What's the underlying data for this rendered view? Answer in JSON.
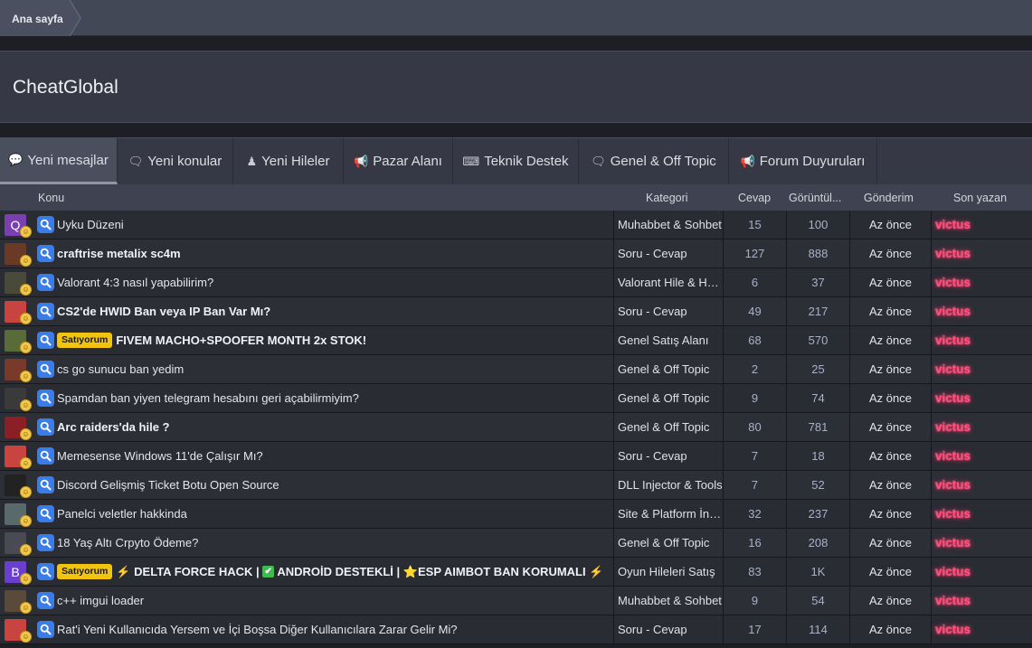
{
  "breadcrumb": {
    "home": "Ana sayfa"
  },
  "page": {
    "title": "CheatGlobal"
  },
  "tabs": [
    {
      "label": "Yeni mesajlar",
      "icon": "speech-bubble-icon",
      "active": true
    },
    {
      "label": "Yeni konular",
      "icon": "chat-bubbles-icon",
      "active": false
    },
    {
      "label": "Yeni Hileler",
      "icon": "user-secret-icon",
      "active": false
    },
    {
      "label": "Pazar Alanı",
      "icon": "megaphone-icon",
      "active": false
    },
    {
      "label": "Teknik Destek",
      "icon": "keyboard-icon",
      "active": false
    },
    {
      "label": "Genel & Off Topic",
      "icon": "chat-bubbles-icon",
      "active": false
    },
    {
      "label": "Forum Duyuruları",
      "icon": "megaphone-icon",
      "active": false
    }
  ],
  "table": {
    "headers": {
      "topic": "Konu",
      "category": "Kategori",
      "replies": "Cevap",
      "views": "Görüntül...",
      "posted": "Gönderim",
      "last_poster": "Son yazan"
    },
    "rows": [
      {
        "title": "Uyku Düzeni",
        "bold": false,
        "prefix": "",
        "category": "Muhabbet & Sohbet",
        "replies": "15",
        "views": "100",
        "time": "Az önce",
        "user": "victus",
        "avatar_color": "#7a3fb0",
        "avatar_letter": "Q"
      },
      {
        "title": "craftrise metalix sc4m",
        "bold": true,
        "prefix": "",
        "category": "Soru - Cevap",
        "replies": "127",
        "views": "888",
        "time": "Az önce",
        "user": "victus",
        "avatar_color": "#6b3a26",
        "avatar_letter": ""
      },
      {
        "title": "Valorant 4:3 nasıl yapabilirim?",
        "bold": false,
        "prefix": "",
        "category": "Valorant Hile & Hack",
        "replies": "6",
        "views": "37",
        "time": "Az önce",
        "user": "victus",
        "avatar_color": "#4a4a3a",
        "avatar_letter": ""
      },
      {
        "title": "CS2'de HWID Ban veya IP Ban Var Mı?",
        "bold": true,
        "prefix": "",
        "category": "Soru - Cevap",
        "replies": "49",
        "views": "217",
        "time": "Az önce",
        "user": "victus",
        "avatar_color": "#c9443e",
        "avatar_letter": ""
      },
      {
        "title": "FIVEM MACHO+SPOOFER MONTH 2x STOK!",
        "bold": true,
        "prefix": "Satıyorum",
        "category": "Genel Satış Alanı",
        "replies": "68",
        "views": "570",
        "time": "Az önce",
        "user": "victus",
        "avatar_color": "#5a6b3a",
        "avatar_letter": ""
      },
      {
        "title": "cs go sunucu ban yedim",
        "bold": false,
        "prefix": "",
        "category": "Genel & Off Topic",
        "replies": "2",
        "views": "25",
        "time": "Az önce",
        "user": "victus",
        "avatar_color": "#7a3a2a",
        "avatar_letter": ""
      },
      {
        "title": "Spamdan ban yiyen telegram hesabını geri açabilirmiyim?",
        "bold": false,
        "prefix": "",
        "category": "Genel & Off Topic",
        "replies": "9",
        "views": "74",
        "time": "Az önce",
        "user": "victus",
        "avatar_color": "#3a3a3a",
        "avatar_letter": ""
      },
      {
        "title": "Arc raiders'da hile ?",
        "bold": true,
        "prefix": "",
        "category": "Genel & Off Topic",
        "replies": "80",
        "views": "781",
        "time": "Az önce",
        "user": "victus",
        "avatar_color": "#8a1f26",
        "avatar_letter": ""
      },
      {
        "title": "Memesense Windows 11'de Çalışır Mı?",
        "bold": false,
        "prefix": "",
        "category": "Soru - Cevap",
        "replies": "7",
        "views": "18",
        "time": "Az önce",
        "user": "victus",
        "avatar_color": "#c9443e",
        "avatar_letter": ""
      },
      {
        "title": "Discord Gelişmiş Ticket Botu Open Source",
        "bold": false,
        "prefix": "",
        "category": "DLL Injector & Tools",
        "replies": "7",
        "views": "52",
        "time": "Az önce",
        "user": "victus",
        "avatar_color": "#222222",
        "avatar_letter": ""
      },
      {
        "title": "Panelci veletler hakkinda",
        "bold": false,
        "prefix": "",
        "category": "Site & Platform İncelemeleri",
        "replies": "32",
        "views": "237",
        "time": "Az önce",
        "user": "victus",
        "avatar_color": "#5a6a6a",
        "avatar_letter": ""
      },
      {
        "title": "18 Yaş Altı Crpyto Ödeme?",
        "bold": false,
        "prefix": "",
        "category": "Genel & Off Topic",
        "replies": "16",
        "views": "208",
        "time": "Az önce",
        "user": "victus",
        "avatar_color": "#4a4a55",
        "avatar_letter": ""
      },
      {
        "title": "DELTA FORCE HACK | ANDROİD DESTEKLİ | ESP AIMBOT BAN KORUMALI",
        "bold": true,
        "prefix": "Satıyorum",
        "category": "Oyun Hileleri Satış",
        "replies": "83",
        "views": "1K",
        "time": "Az önce",
        "user": "victus",
        "avatar_color": "#6a3fd0",
        "avatar_letter": "B",
        "emoji": true
      },
      {
        "title": "c++ imgui loader",
        "bold": false,
        "prefix": "",
        "category": "Muhabbet & Sohbet",
        "replies": "9",
        "views": "54",
        "time": "Az önce",
        "user": "victus",
        "avatar_color": "#5a4a3a",
        "avatar_letter": ""
      },
      {
        "title": "Rat'i Yeni Kullanıcıda Yersem ve İçi Boşsa Diğer Kullanıcılara Zarar Gelir Mi?",
        "bold": false,
        "prefix": "",
        "category": "Soru - Cevap",
        "replies": "17",
        "views": "114",
        "time": "Az önce",
        "user": "victus",
        "avatar_color": "#c9443e",
        "avatar_letter": ""
      }
    ]
  },
  "colors": {
    "accent_user": "#ff4f7d",
    "prefix": "#f2c40f",
    "search_icon": "#3a7de8"
  }
}
